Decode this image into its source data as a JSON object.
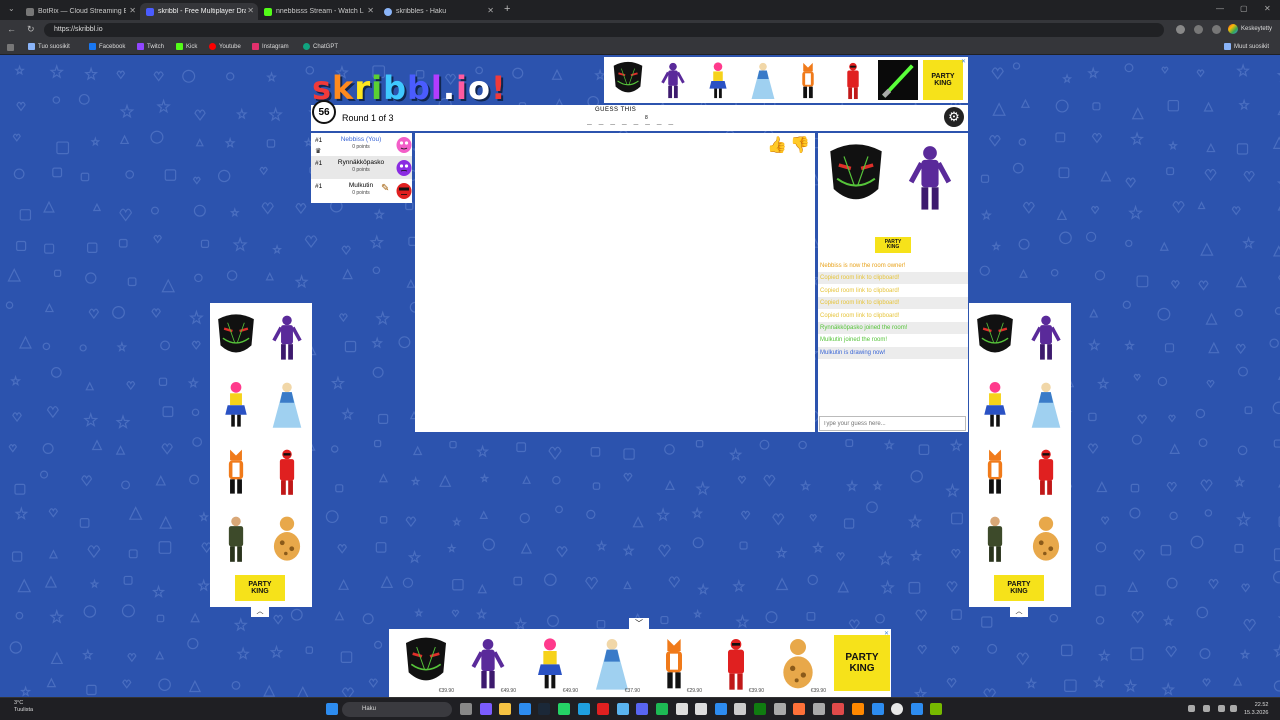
{
  "browser": {
    "tabs": [
      {
        "label": "BotRix — Cloud Streaming Bot for",
        "favicon": "botrix-icon",
        "active": false
      },
      {
        "label": "skribbl - Free Multiplayer Drawing",
        "favicon": "skribbl-icon",
        "active": true
      },
      {
        "label": "nnebbisss Stream - Watch Live o",
        "favicon": "kick-icon",
        "active": false
      },
      {
        "label": "skribbles - Haku",
        "favicon": "search-icon",
        "active": false
      }
    ],
    "url": "https://skribbl.io",
    "profile_label": "Keskeytetty",
    "bookmarks": [
      {
        "label": "Tuo suosikit",
        "color": "#8ab4f8"
      },
      {
        "label": "Facebook",
        "color": "#1877f2"
      },
      {
        "label": "Twitch",
        "color": "#9146ff"
      },
      {
        "label": "Kick",
        "color": "#53fc18"
      },
      {
        "label": "Youtube",
        "color": "#ff0000"
      },
      {
        "label": "Instagram",
        "color": "#e1306c"
      },
      {
        "label": "ChatGPT",
        "color": "#10a37f"
      }
    ],
    "all_bookmarks_label": "Muut suosikit"
  },
  "game": {
    "logo_letters": [
      "s",
      "k",
      "r",
      "i",
      "b",
      "b",
      "l",
      ".",
      "i",
      "o",
      "!"
    ],
    "logo_colors": [
      "#f03a3a",
      "#ff8a1e",
      "#ffe620",
      "#5ad132",
      "#3fc8ff",
      "#4a5cff",
      "#b33cff",
      "#ffffff",
      "#ff5aa0",
      "#ffffff",
      "#f03a3a"
    ],
    "timer": "56",
    "round_label": "Round 1 of 3",
    "guess_label": "GUESS THIS",
    "word_blanks": "_ _ _ _ _ _ _ _",
    "word_length": "8",
    "players": [
      {
        "rank": "#1",
        "name": "Nebbiss (You)",
        "points": "0 points",
        "is_you": true,
        "avatar_color": "#f35ec8"
      },
      {
        "rank": "#1",
        "name": "Rynnäkköpasko",
        "points": "0 points",
        "is_you": false,
        "avatar_color": "#8a2be2"
      },
      {
        "rank": "#1",
        "name": "Mulkutin",
        "points": "0 points",
        "is_you": false,
        "avatar_color": "#e02020",
        "drawing": true
      }
    ],
    "chat_messages": [
      {
        "text": "Nebbiss is now the room owner!",
        "color": "#e8a21a"
      },
      {
        "text": "Copied room link to clipboard!",
        "color": "#e6c43a"
      },
      {
        "text": "Copied room link to clipboard!",
        "color": "#e6c43a"
      },
      {
        "text": "Copied room link to clipboard!",
        "color": "#e6c43a"
      },
      {
        "text": "Copied room link to clipboard!",
        "color": "#e6c43a"
      },
      {
        "text": "Rynnäkköpasko joined the room!",
        "color": "#56c43a"
      },
      {
        "text": "Mulkutin joined the room!",
        "color": "#56c43a"
      },
      {
        "text": "Mulkutin is drawing now!",
        "color": "#3a66d6"
      }
    ],
    "guess_placeholder": "Type your guess here..."
  },
  "ads": {
    "brand_line1": "PARTY",
    "brand_line2": "KING",
    "bottom_prices": [
      "€39.90",
      "€49.90",
      "€49.90",
      "€37.90",
      "€29.90",
      "€39.90",
      "€39.90"
    ]
  },
  "taskbar": {
    "weather_temp": "3°C",
    "weather_desc": "Tuulista",
    "search_label": "Haku",
    "time": "22.52",
    "date": "15.3.2026"
  }
}
